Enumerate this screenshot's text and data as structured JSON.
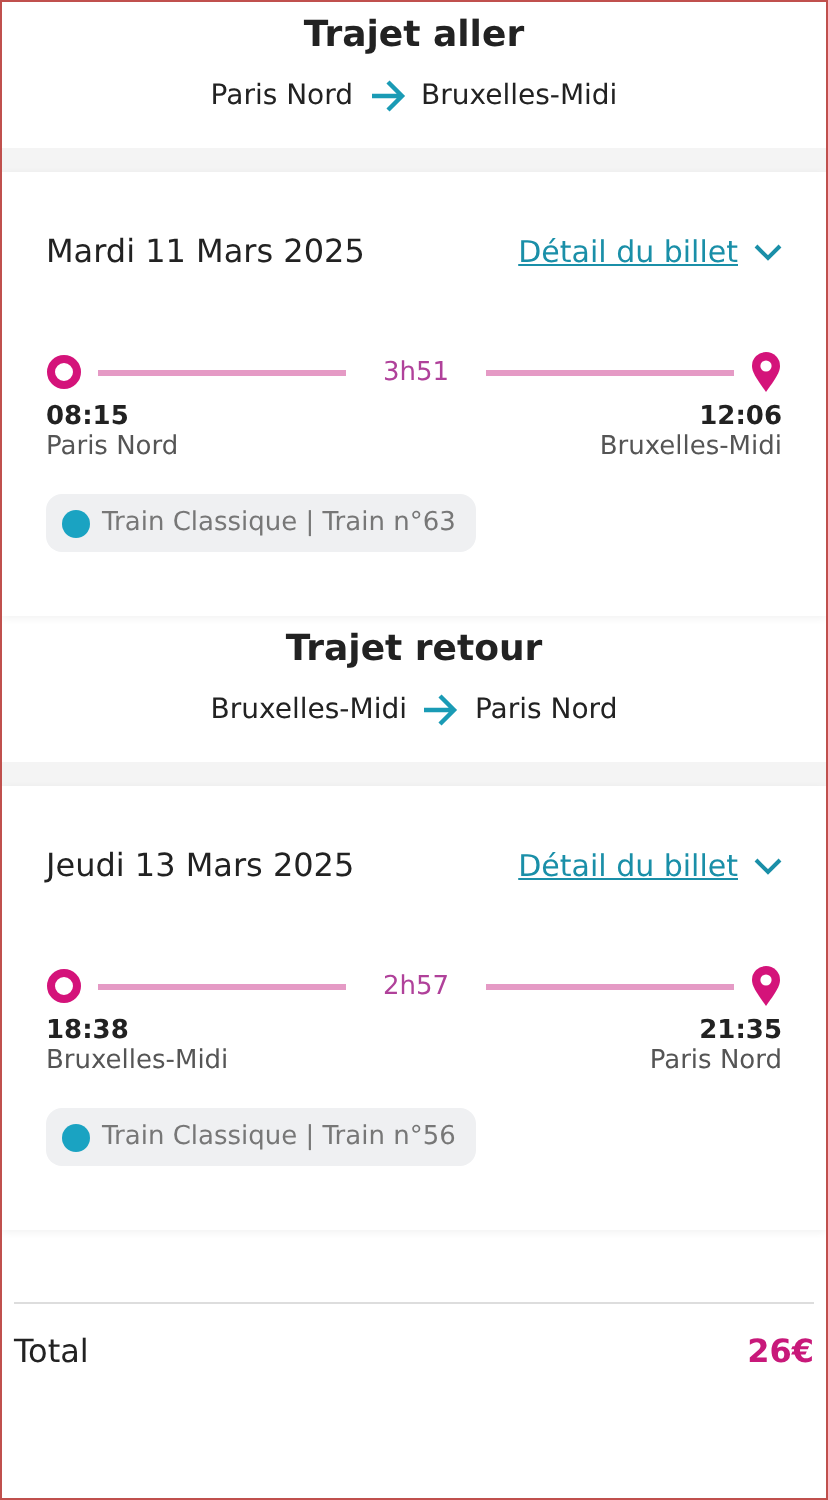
{
  "trips": [
    {
      "title": "Trajet aller",
      "from": "Paris Nord",
      "to": "Bruxelles-Midi",
      "date": "Mardi 11 Mars 2025",
      "detail_link": "Détail du billet",
      "duration": "3h51",
      "departure": {
        "time": "08:15",
        "station": "Paris Nord"
      },
      "arrival": {
        "time": "12:06",
        "station": "Bruxelles-Midi"
      },
      "train": "Train Classique | Train n°63"
    },
    {
      "title": "Trajet retour",
      "from": "Bruxelles-Midi",
      "to": "Paris Nord",
      "date": "Jeudi 13 Mars 2025",
      "detail_link": "Détail du billet",
      "duration": "2h57",
      "departure": {
        "time": "18:38",
        "station": "Bruxelles-Midi"
      },
      "arrival": {
        "time": "21:35",
        "station": "Paris Nord"
      },
      "train": "Train Classique | Train n°56"
    }
  ],
  "total": {
    "label": "Total",
    "amount": "26€"
  }
}
